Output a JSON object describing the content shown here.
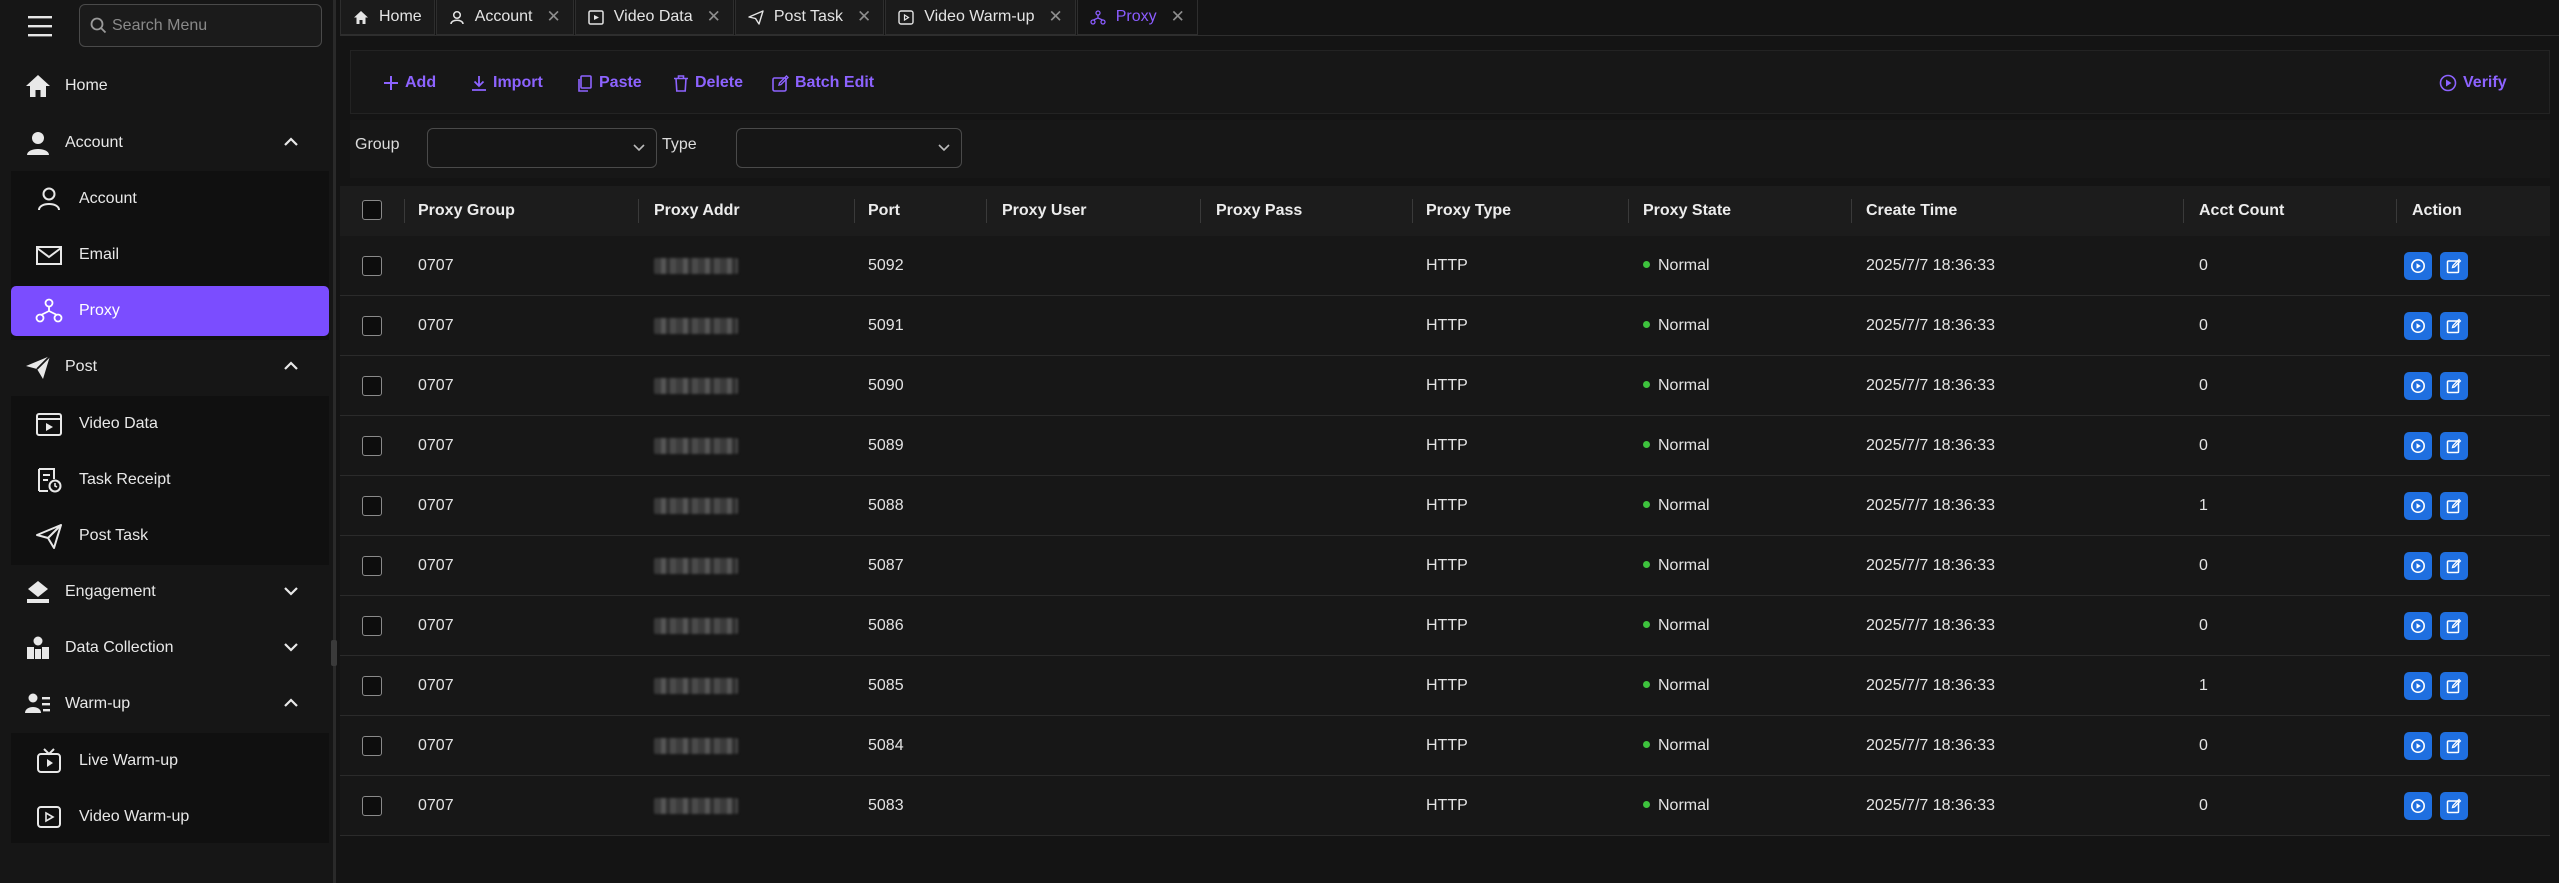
{
  "sidebar": {
    "search_placeholder": "Search Menu",
    "items": [
      {
        "label": "Home",
        "icon": "home-icon"
      },
      {
        "label": "Account",
        "icon": "user-icon"
      },
      {
        "label": "Account",
        "icon": "user-outline-icon"
      },
      {
        "label": "Email",
        "icon": "mail-icon"
      },
      {
        "label": "Proxy",
        "icon": "network-icon"
      },
      {
        "label": "Post",
        "icon": "send-icon"
      },
      {
        "label": "Video Data",
        "icon": "video-icon"
      },
      {
        "label": "Task Receipt",
        "icon": "receipt-icon"
      },
      {
        "label": "Post Task",
        "icon": "paper-plane-icon"
      },
      {
        "label": "Engagement",
        "icon": "engagement-icon"
      },
      {
        "label": "Data Collection",
        "icon": "data-collection-icon"
      },
      {
        "label": "Warm-up",
        "icon": "warmup-icon"
      },
      {
        "label": "Live Warm-up",
        "icon": "live-icon"
      },
      {
        "label": "Video Warm-up",
        "icon": "video-play-icon"
      }
    ],
    "active": "Proxy",
    "accent": "#7b4dff"
  },
  "tabs": [
    {
      "label": "Home",
      "icon": "home-icon",
      "closable": false
    },
    {
      "label": "Account",
      "icon": "user-outline-icon",
      "closable": true
    },
    {
      "label": "Video Data",
      "icon": "video-icon",
      "closable": true
    },
    {
      "label": "Post Task",
      "icon": "paper-plane-icon",
      "closable": true
    },
    {
      "label": "Video Warm-up",
      "icon": "video-play-icon",
      "closable": true
    },
    {
      "label": "Proxy",
      "icon": "network-icon",
      "closable": true,
      "active": true
    }
  ],
  "toolbar": {
    "add": "Add",
    "import": "Import",
    "paste": "Paste",
    "delete": "Delete",
    "batch_edit": "Batch Edit",
    "verify": "Verify"
  },
  "filter": {
    "group_label": "Group",
    "group_value": "",
    "type_label": "Type",
    "type_value": ""
  },
  "table": {
    "columns": [
      "Proxy Group",
      "Proxy Addr",
      "Port",
      "Proxy User",
      "Proxy Pass",
      "Proxy Type",
      "Proxy State",
      "Create Time",
      "Acct Count",
      "Action"
    ],
    "rows": [
      {
        "group": "0707",
        "port": "5092",
        "user": "",
        "pass": "",
        "type": "HTTP",
        "state": "Normal",
        "created": "2025/7/7 18:36:33",
        "count": "0"
      },
      {
        "group": "0707",
        "port": "5091",
        "user": "",
        "pass": "",
        "type": "HTTP",
        "state": "Normal",
        "created": "2025/7/7 18:36:33",
        "count": "0"
      },
      {
        "group": "0707",
        "port": "5090",
        "user": "",
        "pass": "",
        "type": "HTTP",
        "state": "Normal",
        "created": "2025/7/7 18:36:33",
        "count": "0"
      },
      {
        "group": "0707",
        "port": "5089",
        "user": "",
        "pass": "",
        "type": "HTTP",
        "state": "Normal",
        "created": "2025/7/7 18:36:33",
        "count": "0"
      },
      {
        "group": "0707",
        "port": "5088",
        "user": "",
        "pass": "",
        "type": "HTTP",
        "state": "Normal",
        "created": "2025/7/7 18:36:33",
        "count": "1"
      },
      {
        "group": "0707",
        "port": "5087",
        "user": "",
        "pass": "",
        "type": "HTTP",
        "state": "Normal",
        "created": "2025/7/7 18:36:33",
        "count": "0"
      },
      {
        "group": "0707",
        "port": "5086",
        "user": "",
        "pass": "",
        "type": "HTTP",
        "state": "Normal",
        "created": "2025/7/7 18:36:33",
        "count": "0"
      },
      {
        "group": "0707",
        "port": "5085",
        "user": "",
        "pass": "",
        "type": "HTTP",
        "state": "Normal",
        "created": "2025/7/7 18:36:33",
        "count": "1"
      },
      {
        "group": "0707",
        "port": "5084",
        "user": "",
        "pass": "",
        "type": "HTTP",
        "state": "Normal",
        "created": "2025/7/7 18:36:33",
        "count": "0"
      },
      {
        "group": "0707",
        "port": "5083",
        "user": "",
        "pass": "",
        "type": "HTTP",
        "state": "Normal",
        "created": "2025/7/7 18:36:33",
        "count": "0"
      }
    ],
    "state_color": "#3ec23e",
    "action_color": "#1f6fe0"
  }
}
